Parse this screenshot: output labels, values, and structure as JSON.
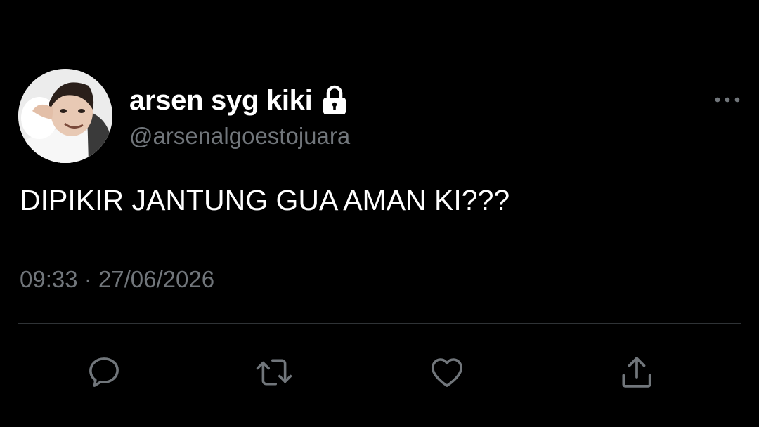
{
  "tweet": {
    "display_name": "arsen syg kiki",
    "handle": "@arsenalgoestojuara",
    "text": "DIPIKIR JANTUNG GUA AMAN KI???",
    "timestamp": "09:33 · 27/06/2026",
    "protected_icon": "lock-icon",
    "more_icon": "more-horizontal-icon"
  },
  "actions": [
    {
      "icon": "reply-icon"
    },
    {
      "icon": "retweet-icon"
    },
    {
      "icon": "like-icon"
    },
    {
      "icon": "share-icon"
    }
  ],
  "colors": {
    "background": "#000000",
    "primary_text": "#ffffff",
    "secondary_text": "#71767b",
    "divider": "#2f3336",
    "icon": "#71767b"
  }
}
